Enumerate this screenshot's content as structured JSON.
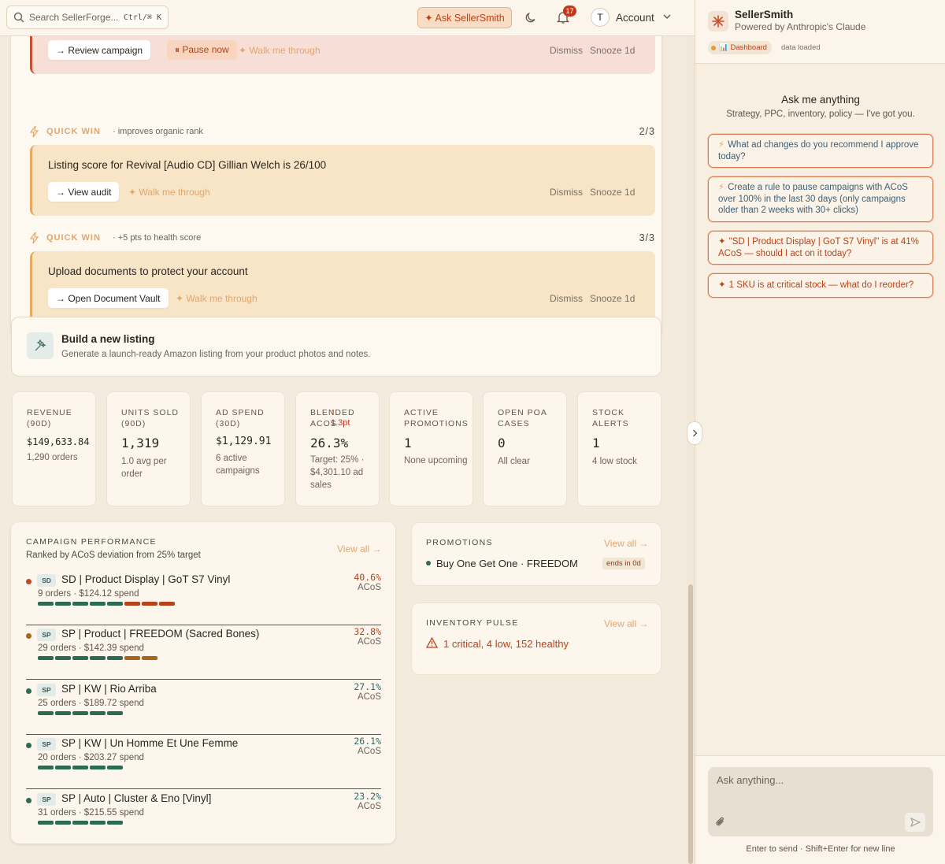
{
  "topbar": {
    "search_placeholder": "Search SellerForge...",
    "search_shortcut": "Ctrl/⌘ K",
    "ask_label": "✦ Ask SellerSmith",
    "notifications_count": "17",
    "avatar_initial": "T",
    "account_label": "Account"
  },
  "alerts": {
    "first": {
      "primary": "→ Review campaign",
      "pause": "⏸ Pause now",
      "walk": "✦ Walk me through",
      "dismiss": "Dismiss",
      "snooze": "Snooze 1d"
    },
    "quick_wins": [
      {
        "label": "QUICK WIN",
        "note": "· improves organic rank",
        "count": "2/3",
        "title": "Listing score for Revival [Audio CD] Gillian Welch is 26/100",
        "action": "→ View audit",
        "walk": "✦ Walk me through",
        "dismiss": "Dismiss",
        "snooze": "Snooze 1d"
      },
      {
        "label": "QUICK WIN",
        "note": "· +5 pts to health score",
        "count": "3/3",
        "title": "Upload documents to protect your account",
        "action": "→ Open Document Vault",
        "walk": "✦ Walk me through",
        "dismiss": "Dismiss",
        "snooze": "Snooze 1d"
      }
    ]
  },
  "build": {
    "title": "Build a new listing",
    "subtitle": "Generate a launch-ready Amazon listing from your product photos and notes."
  },
  "kpis": [
    {
      "label": "REVENUE (90D)",
      "value": "$149,633.84",
      "sub": "1,290 orders"
    },
    {
      "label": "UNITS SOLD (90D)",
      "value": "1,319",
      "sub": "1.0 avg per order"
    },
    {
      "label": "AD SPEND (30D)",
      "value": "$1,129.91",
      "sub": "6 active campaigns"
    },
    {
      "label": "BLENDED ACOS",
      "delta": "↑ 1.3pt",
      "value": "26.3%",
      "sub": "Target: 25% · $4,301.10 ad sales"
    },
    {
      "label": "ACTIVE PROMOTIONS",
      "value": "1",
      "sub": "None upcoming"
    },
    {
      "label": "OPEN POA CASES",
      "value": "0",
      "sub": "All clear"
    },
    {
      "label": "STOCK ALERTS",
      "value": "1",
      "sub": "4 low stock"
    }
  ],
  "campaigns": {
    "title": "CAMPAIGN PERFORMANCE",
    "subtitle": "Ranked by ACoS deviation from 25% target",
    "view_all": "View all →",
    "acos_label": "ACoS",
    "rows": [
      {
        "type": "SD",
        "name": "SD | Product Display | GoT S7 Vinyl",
        "meta": "9 orders · $124.12 spend",
        "acos": "40.6%",
        "status_color": "#c04a26",
        "acos_color": "#b8421a",
        "bars": [
          "#2c6b52",
          "#2c6b52",
          "#2c6b52",
          "#2c6b52",
          "#2c6b52",
          "#b8421a",
          "#b8421a",
          "#b8421a"
        ]
      },
      {
        "type": "SP",
        "name": "SP | Product | FREEDOM (Sacred Bones)",
        "meta": "29 orders · $142.39 spend",
        "acos": "32.8%",
        "status_color": "#a8651e",
        "acos_color": "#b8421a",
        "bars": [
          "#2c6b52",
          "#2c6b52",
          "#2c6b52",
          "#2c6b52",
          "#2c6b52",
          "#a8651e",
          "#a8651e"
        ]
      },
      {
        "type": "SP",
        "name": "SP | KW | Rio Arriba",
        "meta": "25 orders · $189.72 spend",
        "acos": "27.1%",
        "status_color": "#2c6b52",
        "acos_color": "#2d6a6a",
        "bars": [
          "#2c6b52",
          "#2c6b52",
          "#2c6b52",
          "#2c6b52",
          "#2c6b52"
        ]
      },
      {
        "type": "SP",
        "name": "SP | KW | Un Homme Et Une Femme",
        "meta": "20 orders · $203.27 spend",
        "acos": "26.1%",
        "status_color": "#2c6b52",
        "acos_color": "#2d6a6a",
        "bars": [
          "#2c6b52",
          "#2c6b52",
          "#2c6b52",
          "#2c6b52",
          "#2c6b52"
        ]
      },
      {
        "type": "SP",
        "name": "SP | Auto | Cluster & Eno [Vinyl]",
        "meta": "31 orders · $215.55 spend",
        "acos": "23.2%",
        "status_color": "#2c6b52",
        "acos_color": "#2d6a6a",
        "bars": [
          "#2c6b52",
          "#2c6b52",
          "#2c6b52",
          "#2c6b52",
          "#2c6b52"
        ]
      }
    ]
  },
  "promotions": {
    "title": "PROMOTIONS",
    "view_all": "View all →",
    "item": "Buy One Get One · FREEDOM",
    "badge": "ends in 0d"
  },
  "inventory": {
    "title": "INVENTORY PULSE",
    "view_all": "View all →",
    "summary": "1 critical, 4 low, 152 healthy"
  },
  "panel": {
    "brand": "SellerSmith",
    "powered_by": "Powered by Anthropic's Claude",
    "context_chip": "📊 Dashboard",
    "context_note": "data loaded",
    "title": "Ask me anything",
    "subtitle": "Strategy, PPC, inventory, policy — I've got you.",
    "suggestions": [
      {
        "icon": "⚡",
        "text": "What ad changes do you recommend I approve today?"
      },
      {
        "icon": "⚡",
        "text": "Create a rule to pause campaigns with ACoS over 100% in the last 30 days (only campaigns older than 2 weeks with 30+ clicks)"
      },
      {
        "icon": "✦",
        "text": "\"SD | Product Display | GoT S7 Vinyl\" is at 41% ACoS — should I act on it today?"
      },
      {
        "icon": "✦",
        "text": "1 SKU is at critical stock — what do I reorder?"
      }
    ],
    "input_placeholder": "Ask anything...",
    "hint": "Enter to send · Shift+Enter for new line"
  }
}
